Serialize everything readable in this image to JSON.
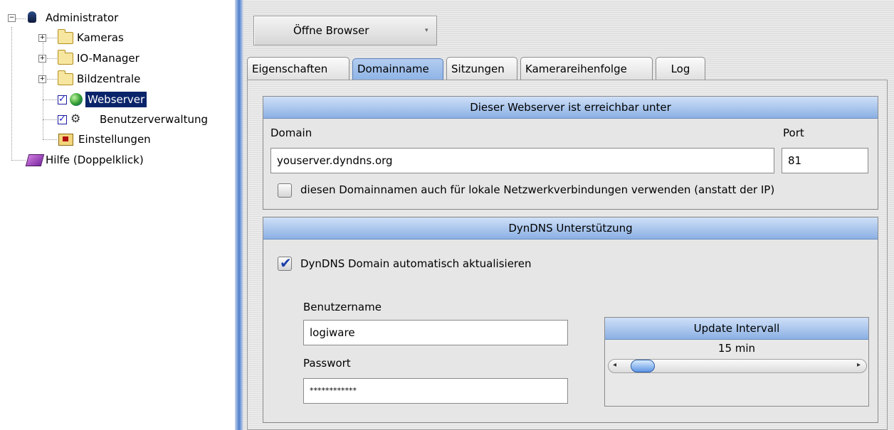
{
  "tree": {
    "root_label": "Administrator",
    "items": [
      {
        "label": "Kameras"
      },
      {
        "label": "IO-Manager"
      },
      {
        "label": "Bildzentrale"
      },
      {
        "label": "Webserver"
      },
      {
        "label": "Benutzerverwaltung"
      },
      {
        "label": "Einstellungen"
      }
    ],
    "help_label": "Hilfe (Doppelklick)",
    "expander_plus": "+",
    "expander_minus": "−"
  },
  "toolbar": {
    "open_browser_label": "Öffne Browser",
    "caret": "▾"
  },
  "tabs": [
    {
      "label": "Eigenschaften"
    },
    {
      "label": "Domainname",
      "active": true
    },
    {
      "label": "Sitzungen"
    },
    {
      "label": "Kamerareihenfolge"
    },
    {
      "label": "Log"
    }
  ],
  "webserver_group": {
    "title": "Dieser Webserver ist erreichbar unter",
    "domain_label": "Domain",
    "domain_value": "youserver.dyndns.org",
    "port_label": "Port",
    "port_value": "81",
    "local_checkbox_label": "diesen Domainnamen auch für lokale Netzwerkverbindungen verwenden (anstatt der IP)",
    "local_checkbox_checked": false
  },
  "dyndns_group": {
    "title": "DynDNS Unterstützung",
    "auto_update_label": "DynDNS Domain automatisch aktualisieren",
    "auto_update_checked": true,
    "username_label": "Benutzername",
    "username_value": "logiware",
    "password_label": "Passwort",
    "password_value": "************",
    "update_interval": {
      "title": "Update Intervall",
      "value_text": "15 min",
      "slider_fraction": 0.05,
      "left_arrow": "◂",
      "right_arrow": "▸"
    }
  },
  "colors": {
    "selection": "#0a246a",
    "header_gradient_top": "#cfe0f7",
    "header_gradient_bottom": "#8bb0e4",
    "check_color": "#1b3fa8"
  }
}
